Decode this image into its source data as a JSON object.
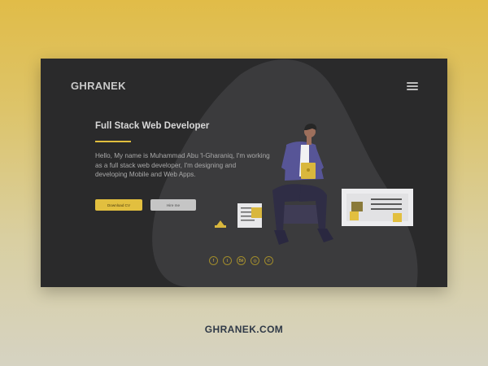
{
  "header": {
    "logo_text": "GHRANEK"
  },
  "hero": {
    "title": "Full Stack Web Developer",
    "intro": "Hello, My name is Muhammad Abu 'l-Gharaniq, I'm working as a full stack web developer, I'm designing and developing Mobile and Web Apps.",
    "buttons": {
      "primary": "Download CV",
      "secondary": "Hire me"
    }
  },
  "socials": [
    {
      "icon": "facebook-icon",
      "glyph": "f"
    },
    {
      "icon": "twitter-icon",
      "glyph": "t"
    },
    {
      "icon": "behance-icon",
      "glyph": "Bē"
    },
    {
      "icon": "github-icon",
      "glyph": "◎"
    },
    {
      "icon": "whatsapp-icon",
      "glyph": "✆"
    }
  ],
  "footer": {
    "brand": "GHRANEK.COM"
  },
  "colors": {
    "accent": "#e2bf3f",
    "card_bg": "#2a2a2b",
    "blob": "#3b3b3d",
    "outer_top": "#e1bc48",
    "outer_bottom": "#d6d3c2"
  }
}
